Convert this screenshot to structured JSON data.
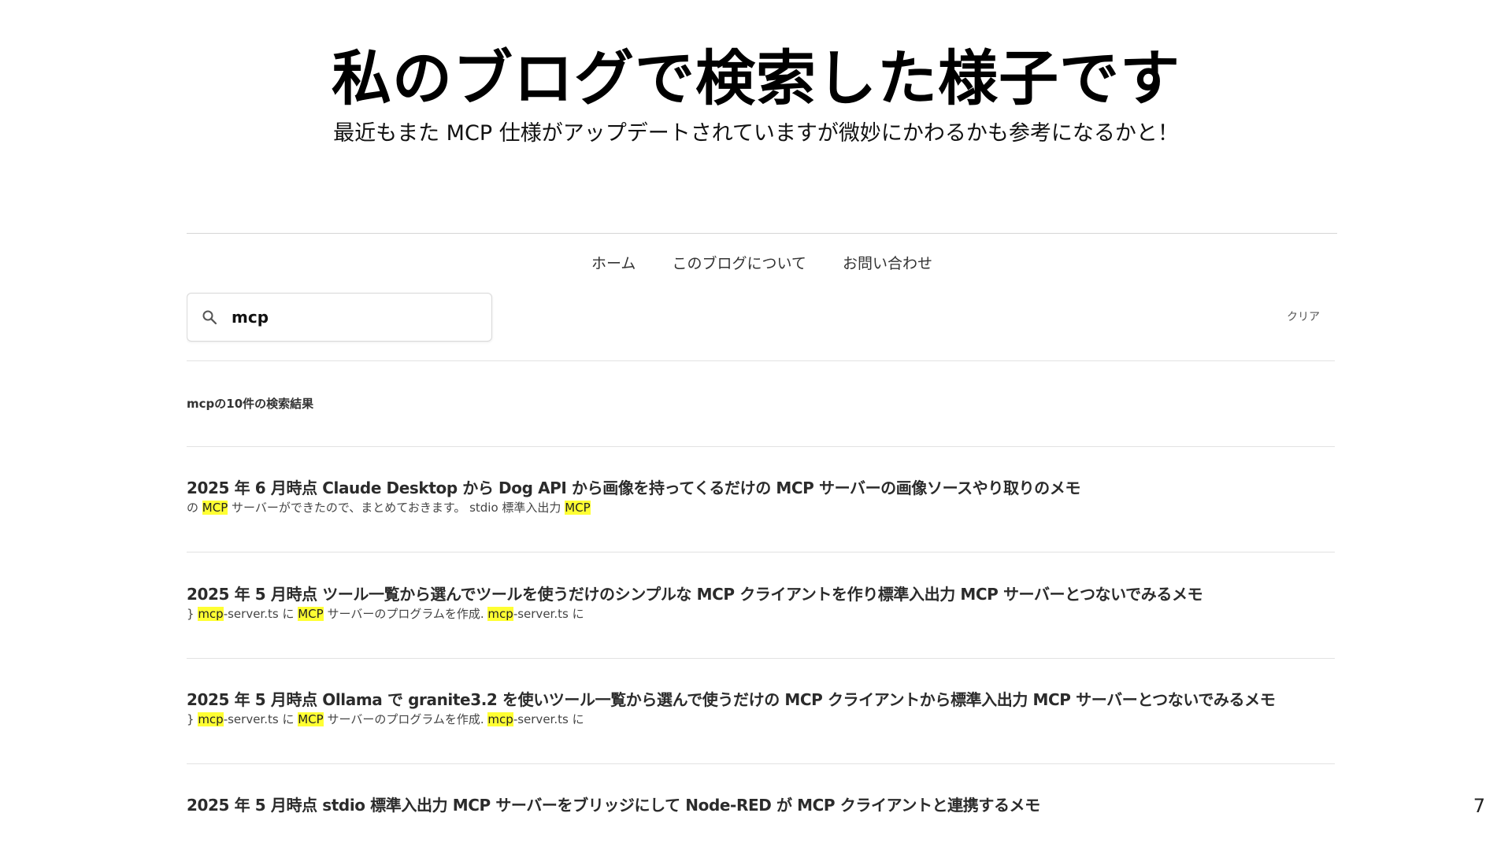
{
  "slide": {
    "title": "私のブログで検索した様子です",
    "subtitle": "最近もまた MCP 仕様がアップデートされていますが微妙にかわるかも参考になるかと！",
    "page_number": "7"
  },
  "nav": {
    "items": [
      {
        "label": "ホーム"
      },
      {
        "label": "このブログについて"
      },
      {
        "label": "お問い合わせ"
      }
    ]
  },
  "search": {
    "value": "mcp",
    "icon": "search-icon",
    "clear_label": "クリア"
  },
  "results": {
    "count_label": "mcpの10件の検索結果",
    "items": [
      {
        "title": "2025 年 6 月時点 Claude Desktop から Dog API から画像を持ってくるだけの MCP サーバーの画像ソースやり取りのメモ",
        "snippet": [
          {
            "t": "の "
          },
          {
            "t": "MCP",
            "hl": true
          },
          {
            "t": " サーバーができたので、まとめておきます。 stdio 標準入出力 "
          },
          {
            "t": "MCP",
            "hl": true
          }
        ]
      },
      {
        "title": "2025 年 5 月時点 ツール一覧から選んでツールを使うだけのシンプルな MCP クライアントを作り標準入出力 MCP サーバーとつないでみるメモ",
        "snippet": [
          {
            "t": "} "
          },
          {
            "t": "mcp",
            "hl": true
          },
          {
            "t": "-server.ts に "
          },
          {
            "t": "MCP",
            "hl": true
          },
          {
            "t": " サーバーのプログラムを作成. "
          },
          {
            "t": "mcp",
            "hl": true
          },
          {
            "t": "-server.ts に"
          }
        ]
      },
      {
        "title": "2025 年 5 月時点 Ollama で granite3.2 を使いツール一覧から選んで使うだけの MCP クライアントから標準入出力 MCP サーバーとつないでみるメモ",
        "snippet": [
          {
            "t": "} "
          },
          {
            "t": "mcp",
            "hl": true
          },
          {
            "t": "-server.ts に "
          },
          {
            "t": "MCP",
            "hl": true
          },
          {
            "t": " サーバーのプログラムを作成. "
          },
          {
            "t": "mcp",
            "hl": true
          },
          {
            "t": "-server.ts に"
          }
        ]
      },
      {
        "title": "2025 年 5 月時点 stdio 標準入出力 MCP サーバーをブリッジにして Node-RED が MCP クライアントと連携するメモ",
        "snippet": []
      }
    ]
  },
  "colors": {
    "highlight": "#ffff33",
    "rule": "#e2e2e2",
    "text": "#2b2b2b"
  }
}
